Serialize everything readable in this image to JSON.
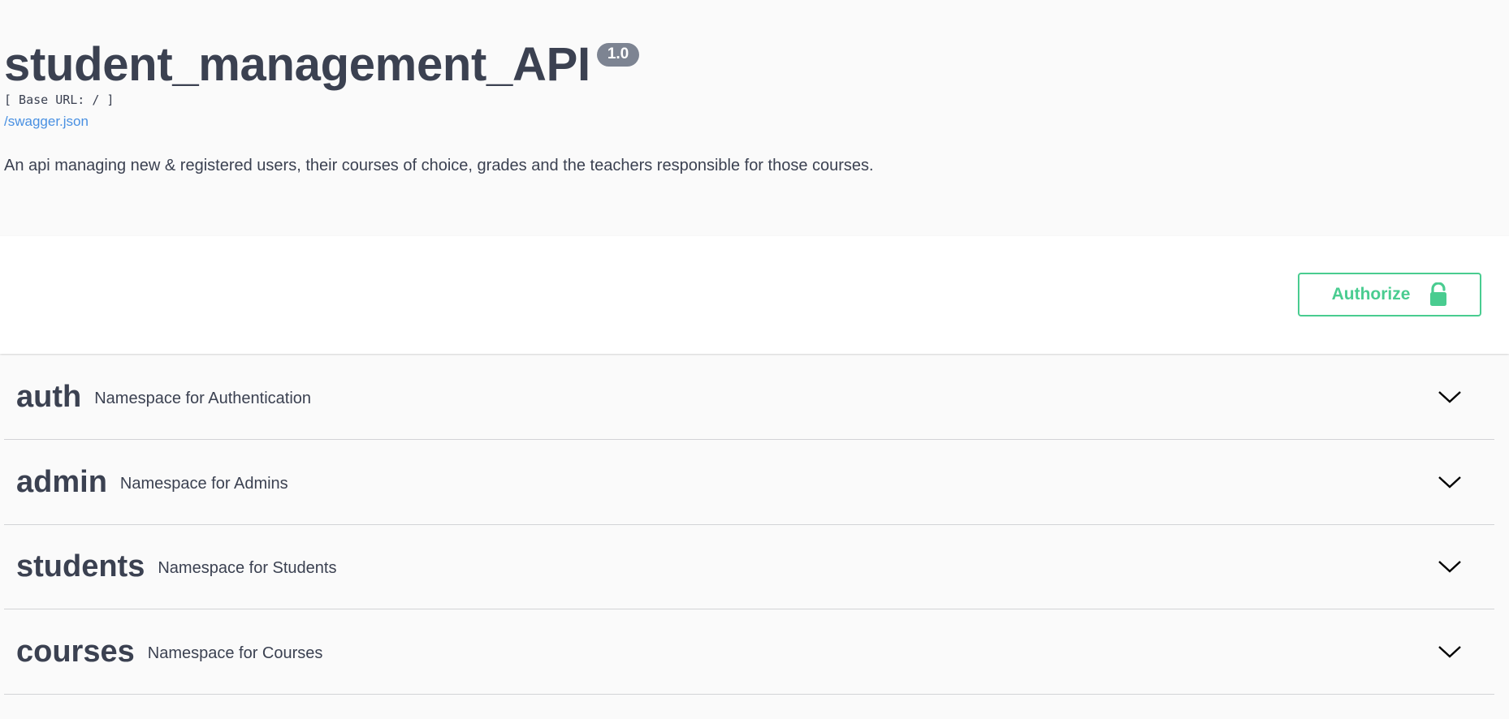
{
  "info": {
    "title": "student_management_API",
    "version": "1.0",
    "base_url": "[ Base URL: / ]",
    "spec_link": "/swagger.json",
    "description": "An api managing new & registered users, their courses of choice, grades and the teachers responsible for those courses."
  },
  "authorize": {
    "label": "Authorize",
    "icon": "unlocked-padlock-icon",
    "color": "#49cc90"
  },
  "sections": [
    {
      "name": "auth",
      "description": "Namespace for Authentication",
      "icon": "chevron-down-icon"
    },
    {
      "name": "admin",
      "description": "Namespace for Admins",
      "icon": "chevron-down-icon"
    },
    {
      "name": "students",
      "description": "Namespace for Students",
      "icon": "chevron-down-icon"
    },
    {
      "name": "courses",
      "description": "Namespace for Courses",
      "icon": "chevron-down-icon"
    }
  ],
  "colors": {
    "text": "#3b4151",
    "link": "#4990e2",
    "version_badge": "#7d8492",
    "background": "#fafafa"
  }
}
